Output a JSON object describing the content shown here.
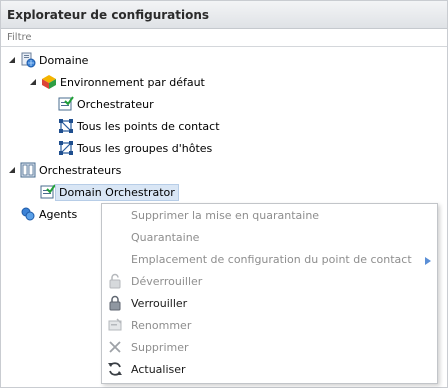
{
  "panel": {
    "title": "Explorateur de configurations",
    "filter_placeholder": "Filtre"
  },
  "tree": {
    "domain": {
      "label": "Domaine",
      "icon": "domain-icon"
    },
    "environment": {
      "label": "Environnement par défaut",
      "icon": "environment-icon"
    },
    "orchestrator_item": {
      "label": "Orchestrateur",
      "icon": "orchestrator-icon"
    },
    "all_contact_points": {
      "label": "Tous les points de contact",
      "icon": "contact-points-icon"
    },
    "all_host_groups": {
      "label": "Tous les groupes d'hôtes",
      "icon": "host-groups-icon"
    },
    "orchestrators": {
      "label": "Orchestrateurs",
      "icon": "orchestrators-icon"
    },
    "domain_orchestrator": {
      "label": "Domain Orchestrator",
      "icon": "orchestrator-icon"
    },
    "agents": {
      "label": "Agents",
      "icon": "agents-icon"
    }
  },
  "context_menu": {
    "items": [
      {
        "label": "Supprimer la mise en quarantaine",
        "enabled": false,
        "icon": ""
      },
      {
        "label": "Quarantaine",
        "enabled": false,
        "icon": ""
      },
      {
        "label": "Emplacement de configuration du point de contact",
        "enabled": false,
        "icon": "",
        "submenu": true
      },
      {
        "label": "Déverrouiller",
        "enabled": false,
        "icon": "unlock-icon"
      },
      {
        "label": "Verrouiller",
        "enabled": true,
        "icon": "lock-icon"
      },
      {
        "label": "Renommer",
        "enabled": false,
        "icon": "rename-icon"
      },
      {
        "label": "Supprimer",
        "enabled": false,
        "icon": "delete-icon"
      },
      {
        "label": "Actualiser",
        "enabled": true,
        "icon": "refresh-icon"
      }
    ]
  },
  "colors": {
    "title_bg_top": "#f3f4f6",
    "title_bg_bottom": "#dfe2e6",
    "selection_bg": "#d9e6f5",
    "disabled_text": "#8e8e8e",
    "submenu_arrow": "#5b8fd6"
  }
}
